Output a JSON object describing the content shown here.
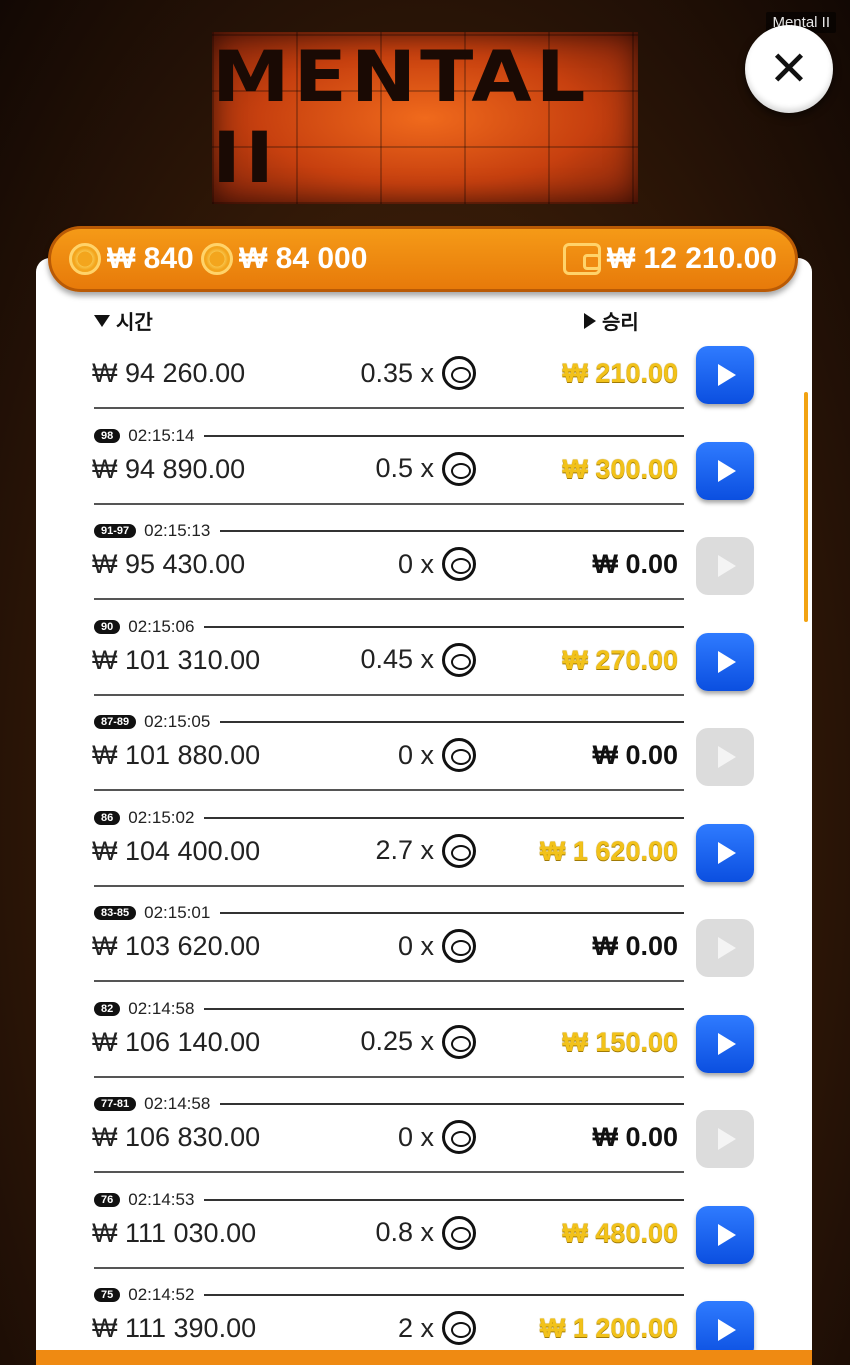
{
  "window_title": "Mental II",
  "logo": {
    "text": "MENTAL II"
  },
  "close_button": {
    "icon": "close-icon",
    "label": "✕"
  },
  "balances": {
    "coin_bet": "₩ 840",
    "coin_total": "₩ 84 000",
    "wallet": "₩ 12 210.00"
  },
  "headers": {
    "time": "시간",
    "win": "승리"
  },
  "rows": [
    {
      "badge": "",
      "time": "",
      "bet": "₩ 94 260.00",
      "mult": "0.35 x",
      "win": "₩ 210.00",
      "win_type": "gold",
      "play_enabled": true
    },
    {
      "badge": "98",
      "time": "02:15:14",
      "bet": "₩ 94 890.00",
      "mult": "0.5 x",
      "win": "₩ 300.00",
      "win_type": "gold",
      "play_enabled": true
    },
    {
      "badge": "91-97",
      "time": "02:15:13",
      "bet": "₩ 95 430.00",
      "mult": "0 x",
      "win": "₩ 0.00",
      "win_type": "zero",
      "play_enabled": false
    },
    {
      "badge": "90",
      "time": "02:15:06",
      "bet": "₩ 101 310.00",
      "mult": "0.45 x",
      "win": "₩ 270.00",
      "win_type": "gold",
      "play_enabled": true
    },
    {
      "badge": "87-89",
      "time": "02:15:05",
      "bet": "₩ 101 880.00",
      "mult": "0 x",
      "win": "₩ 0.00",
      "win_type": "zero",
      "play_enabled": false
    },
    {
      "badge": "86",
      "time": "02:15:02",
      "bet": "₩ 104 400.00",
      "mult": "2.7 x",
      "win": "₩ 1 620.00",
      "win_type": "gold",
      "play_enabled": true
    },
    {
      "badge": "83-85",
      "time": "02:15:01",
      "bet": "₩ 103 620.00",
      "mult": "0 x",
      "win": "₩ 0.00",
      "win_type": "zero",
      "play_enabled": false
    },
    {
      "badge": "82",
      "time": "02:14:58",
      "bet": "₩ 106 140.00",
      "mult": "0.25 x",
      "win": "₩ 150.00",
      "win_type": "gold",
      "play_enabled": true
    },
    {
      "badge": "77-81",
      "time": "02:14:58",
      "bet": "₩ 106 830.00",
      "mult": "0 x",
      "win": "₩ 0.00",
      "win_type": "zero",
      "play_enabled": false
    },
    {
      "badge": "76",
      "time": "02:14:53",
      "bet": "₩ 111 030.00",
      "mult": "0.8 x",
      "win": "₩ 480.00",
      "win_type": "gold",
      "play_enabled": true
    },
    {
      "badge": "75",
      "time": "02:14:52",
      "bet": "₩ 111 390.00",
      "mult": "2 x",
      "win": "₩ 1 200.00",
      "win_type": "gold",
      "play_enabled": true
    }
  ]
}
